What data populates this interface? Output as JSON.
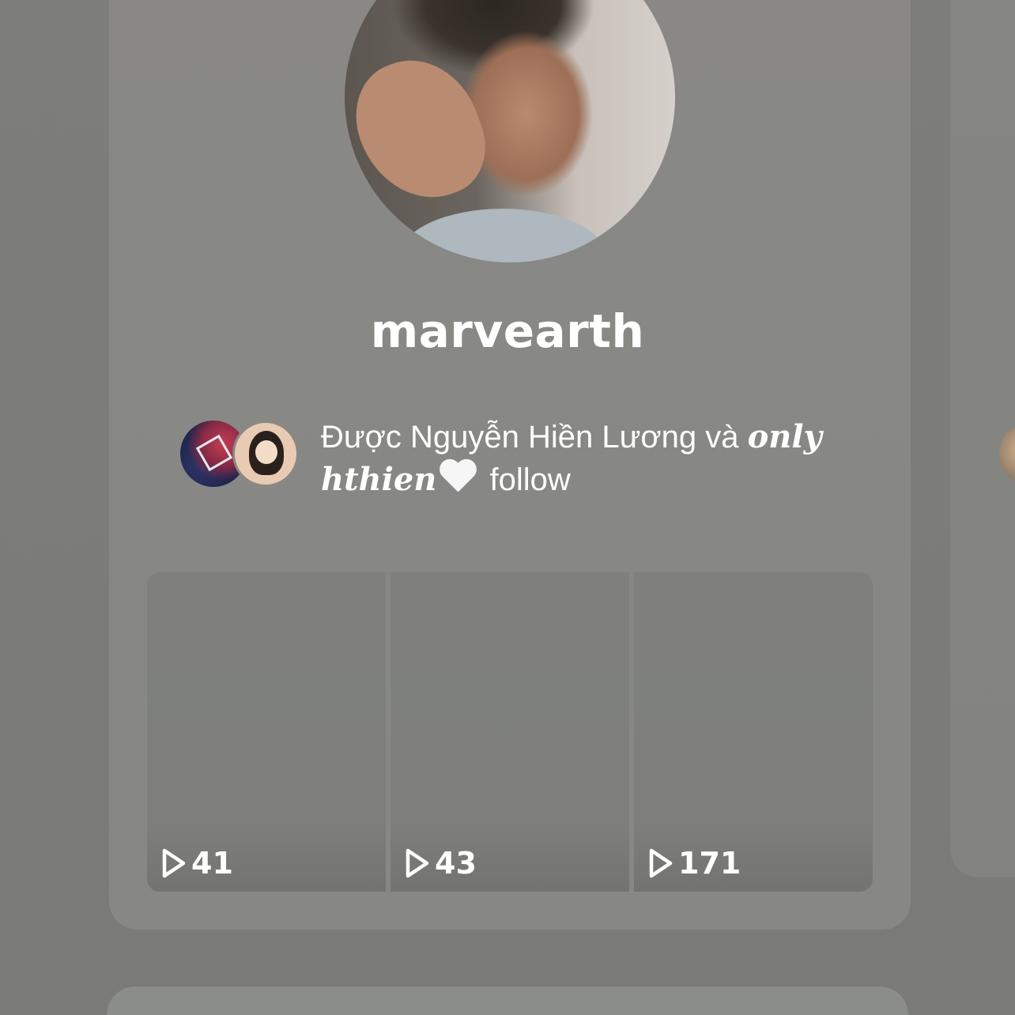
{
  "profile": {
    "username": "marvearth"
  },
  "followed_by": {
    "prefix": "Được Nguyễn Hiền Lương và ",
    "styled_name_part1": "only",
    "styled_name_part2": "hthien",
    "suffix": " follow",
    "avatars": [
      "follower-avatar-1",
      "follower-avatar-2"
    ]
  },
  "videos": [
    {
      "views": "41"
    },
    {
      "views": "43"
    },
    {
      "views": "171"
    }
  ],
  "icons": {
    "play": "play-outline-icon",
    "heart": "white-heart-icon"
  },
  "colors": {
    "background": "#7d7d7b",
    "card": "#898884",
    "text": "#ffffff"
  }
}
